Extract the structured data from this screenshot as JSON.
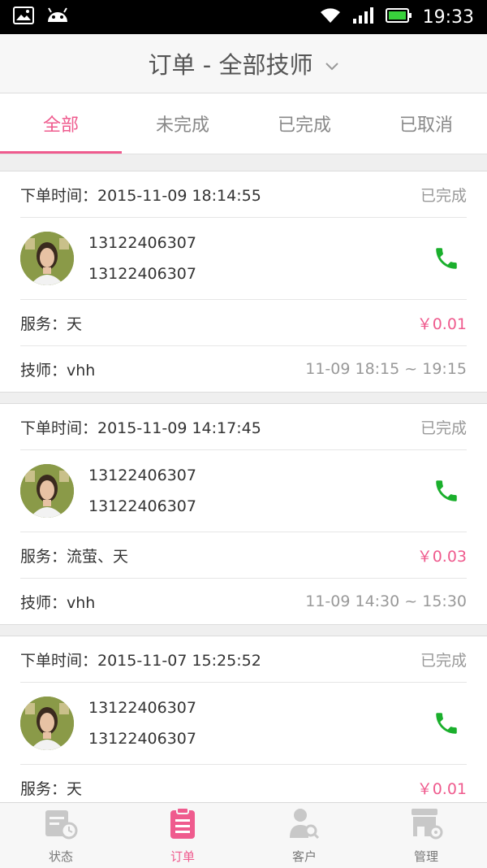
{
  "status_bar": {
    "time": "19:33"
  },
  "header": {
    "title": "订单 - 全部技师"
  },
  "tabs": [
    {
      "label": "全部",
      "active": true
    },
    {
      "label": "未完成",
      "active": false
    },
    {
      "label": "已完成",
      "active": false
    },
    {
      "label": "已取消",
      "active": false
    }
  ],
  "orders": [
    {
      "time_text": "下单时间：2015-11-09 18:14:55",
      "status": "已完成",
      "phone1": "13122406307",
      "phone2": "13122406307",
      "service": "服务：天",
      "price": "￥0.01",
      "tech": "技师：vhh",
      "slot": "11-09 18:15 ~ 19:15"
    },
    {
      "time_text": "下单时间：2015-11-09 14:17:45",
      "status": "已完成",
      "phone1": "13122406307",
      "phone2": "13122406307",
      "service": "服务：流萤、天",
      "price": "￥0.03",
      "tech": "技师：vhh",
      "slot": "11-09 14:30 ~ 15:30"
    },
    {
      "time_text": "下单时间：2015-11-07 15:25:52",
      "status": "已完成",
      "phone1": "13122406307",
      "phone2": "13122406307",
      "service": "服务：天",
      "price": "￥0.01"
    }
  ],
  "bottom_nav": [
    {
      "label": "状态",
      "icon": "status-icon",
      "active": false
    },
    {
      "label": "订单",
      "icon": "order-icon",
      "active": true
    },
    {
      "label": "客户",
      "icon": "customer-icon",
      "active": false
    },
    {
      "label": "管理",
      "icon": "manage-icon",
      "active": false
    }
  ],
  "colors": {
    "accent": "#ef5b8e",
    "call_green": "#1aaf2c"
  }
}
